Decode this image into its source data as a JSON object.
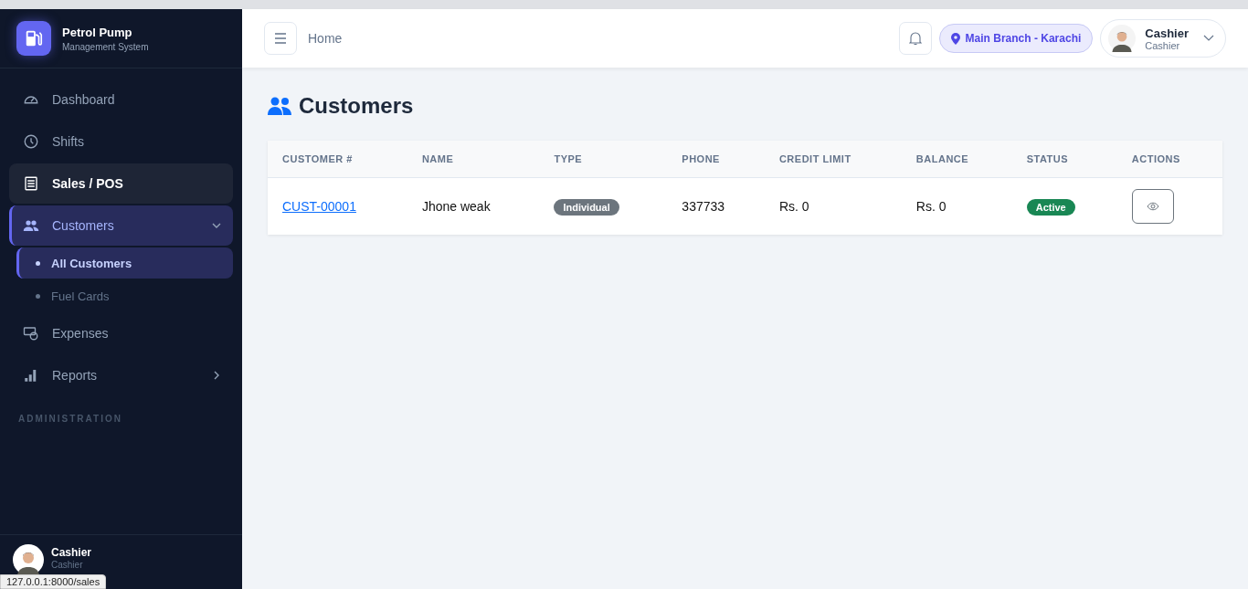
{
  "brand": {
    "title": "Petrol Pump",
    "subtitle": "Management System"
  },
  "nav": [
    {
      "label": "Dashboard",
      "kind": "link",
      "selected": false,
      "hovered": false
    },
    {
      "label": "Shifts",
      "kind": "link",
      "selected": false,
      "hovered": false
    },
    {
      "label": "Sales / POS",
      "kind": "link",
      "selected": false,
      "hovered": true
    },
    {
      "label": "Customers",
      "kind": "group",
      "selected": true,
      "hovered": false,
      "expanded": true,
      "children": [
        {
          "label": "All Customers",
          "selected": true
        },
        {
          "label": "Fuel Cards",
          "selected": false
        }
      ]
    },
    {
      "label": "Expenses",
      "kind": "link",
      "selected": false,
      "hovered": false
    },
    {
      "label": "Reports",
      "kind": "group",
      "selected": false,
      "hovered": false,
      "expanded": false
    },
    {
      "label": "ADMINISTRATION",
      "kind": "section"
    }
  ],
  "sidebar_user": {
    "name": "Cashier",
    "role": "Cashier"
  },
  "status_url": "127.0.0.1:8000/sales",
  "topbar": {
    "breadcrumb": "Home",
    "branch": "Main Branch - Karachi",
    "user": {
      "name": "Cashier",
      "role": "Cashier"
    }
  },
  "page_title": "Customers",
  "table": {
    "columns": [
      "CUSTOMER #",
      "NAME",
      "TYPE",
      "PHONE",
      "CREDIT LIMIT",
      "BALANCE",
      "STATUS",
      "ACTIONS"
    ],
    "rows": [
      {
        "id": "CUST-00001",
        "name": "Jhone weak",
        "type": "Individual",
        "phone": "337733",
        "credit_limit": "Rs. 0",
        "balance": "Rs. 0",
        "status": "Active",
        "color": "#198754"
      }
    ]
  }
}
